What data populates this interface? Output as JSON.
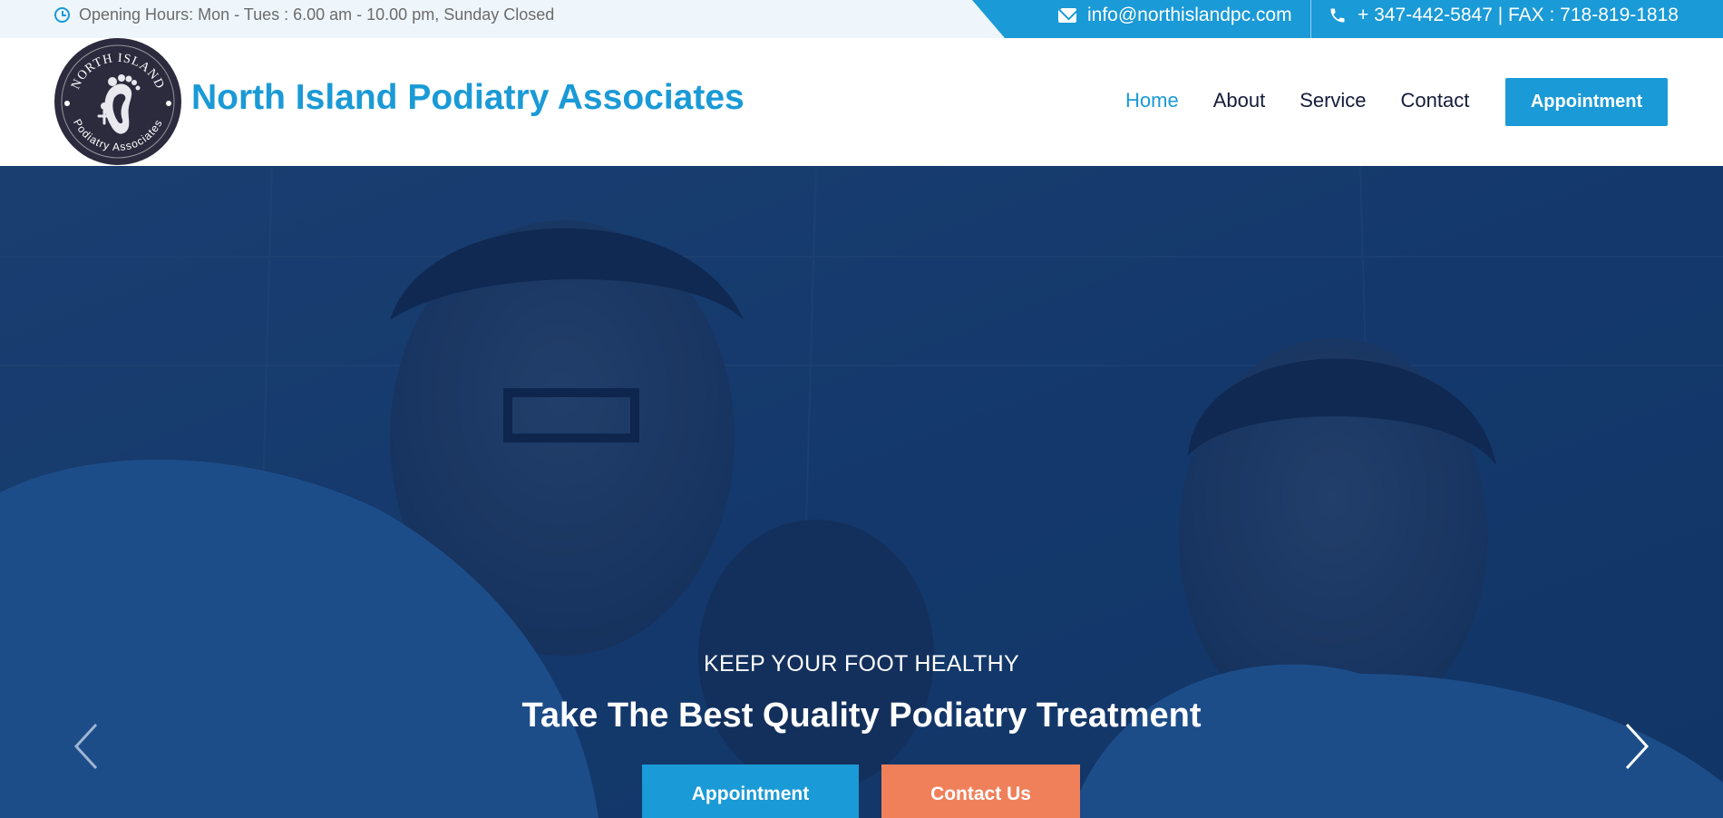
{
  "topbar": {
    "hours": "Opening Hours: Mon - Tues : 6.00 am - 10.00 pm, Sunday Closed",
    "email": "info@northislandpc.com",
    "phone": "+ 347-442-5847 | FAX : 718-819-1818"
  },
  "header": {
    "logo_text_top": "NORTH ISLAND",
    "logo_text_bottom": "Podiatry Associates",
    "site_title": "North Island Podiatry Associates",
    "nav": [
      {
        "label": "Home",
        "active": true
      },
      {
        "label": "About",
        "active": false
      },
      {
        "label": "Service",
        "active": false
      },
      {
        "label": "Contact",
        "active": false
      }
    ],
    "cta_label": "Appointment"
  },
  "hero": {
    "subtitle": "KEEP YOUR FOOT HEALTHY",
    "title": "Take The Best Quality Podiatry Treatment",
    "primary_button": "Appointment",
    "secondary_button": "Contact Us",
    "prev_icon": "chevron-left-icon",
    "next_icon": "chevron-right-icon"
  },
  "colors": {
    "brand_blue": "#1a9ad6",
    "accent_orange": "#f0805a",
    "nav_text": "#141c3a",
    "logo_bg": "#2c2a3d"
  }
}
